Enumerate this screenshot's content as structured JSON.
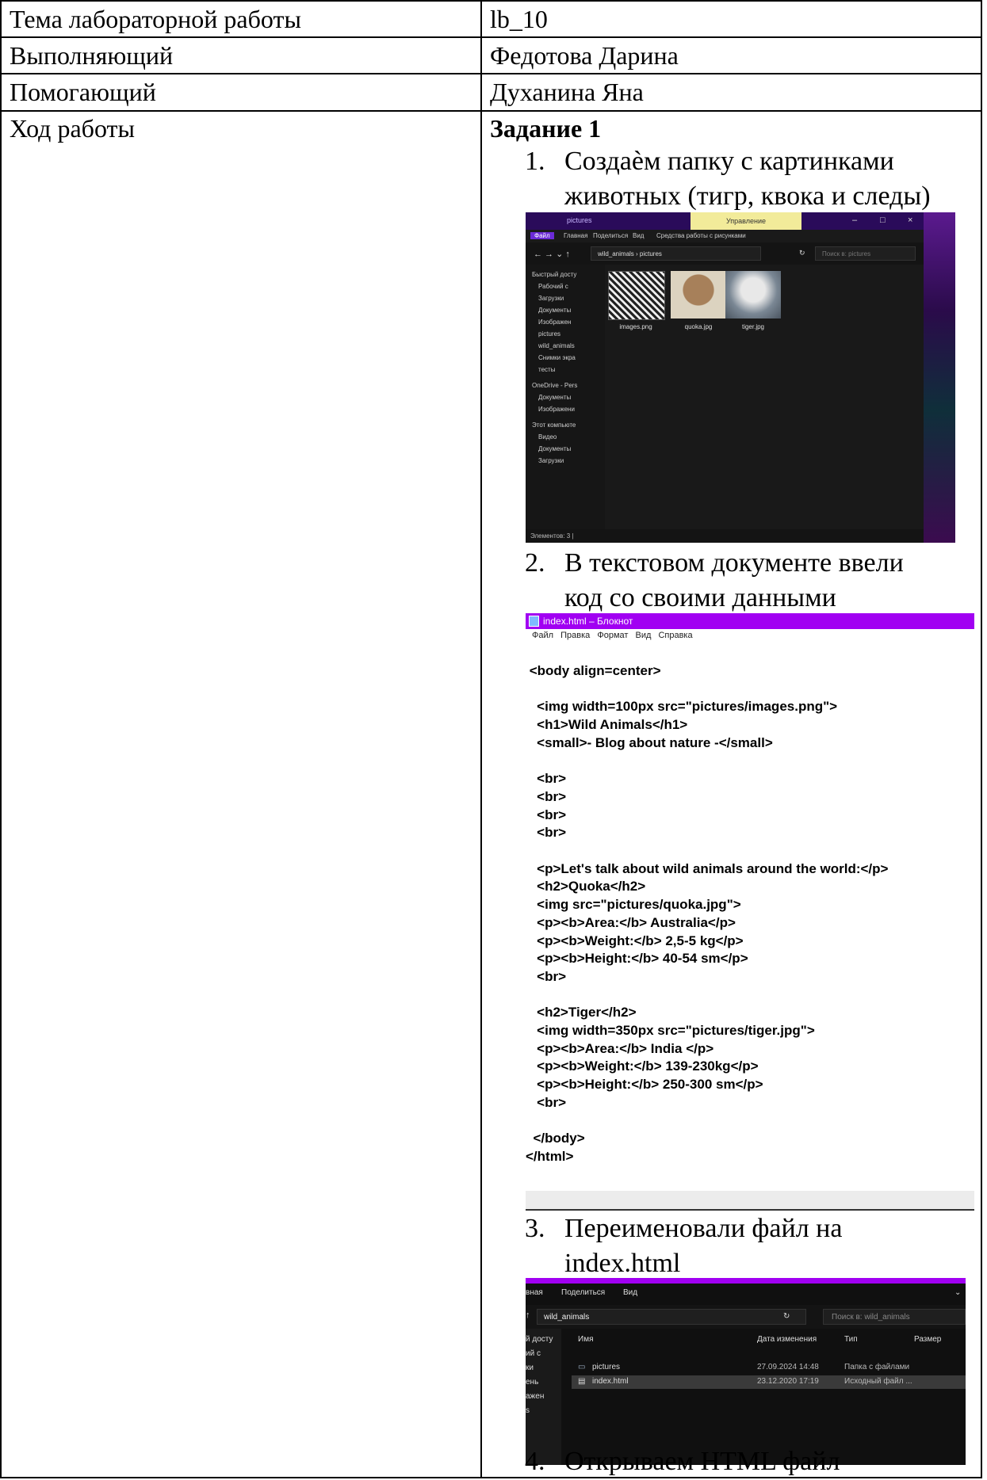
{
  "table": {
    "rows": [
      {
        "label": "Тема лабораторной работы",
        "value": "lb_10"
      },
      {
        "label": "Выполняющий",
        "value": "Федотова Дарина"
      },
      {
        "label": "Помогающий",
        "value": "Духанина Яна"
      },
      {
        "label": "Ход работы",
        "value": "Задание 1"
      }
    ]
  },
  "steps": [
    {
      "num": "1.",
      "lines": [
        "Создаѐм папку с картинками",
        "животных (тигр, квока и следы)"
      ]
    },
    {
      "num": "2.",
      "lines": [
        "В текстовом документе ввели",
        "код со  своими данными"
      ]
    },
    {
      "num": "3.",
      "lines": [
        "Переименовали файл на",
        "index.html"
      ]
    },
    {
      "num": "4.",
      "lines": [
        "Открываем HTML файл"
      ]
    }
  ],
  "explorer1": {
    "title": "pictures",
    "manage": "Управление",
    "ribbon": [
      "Файл",
      "Главная",
      "Поделиться",
      "Вид",
      "Средства работы с рисунками"
    ],
    "path": "wild_animals  ›  pictures",
    "search_placeholder": "Поиск в: pictures",
    "sidebar": [
      "Быстрый досту",
      "Рабочий с",
      "Загрузки",
      "Документы",
      "Изображен",
      "pictures",
      "wild_animals",
      "Снимки экра",
      "тесты",
      "OneDrive - Pers",
      "Документы",
      "Изображени",
      "Этот компьюте",
      "Видео",
      "Документы",
      "Загрузки"
    ],
    "files": [
      "images.png",
      "quoka.jpg",
      "tiger.jpg"
    ],
    "status": "Элементов: 3  |"
  },
  "notepad": {
    "title": "index.html – Блокнот",
    "menu": [
      "Файл",
      "Правка",
      "Формат",
      "Вид",
      "Справка"
    ],
    "code": [
      " <body align=center>",
      "",
      "   <img width=100px src=\"pictures/images.png\">",
      "   <h1>Wild Animals</h1>",
      "   <small>- Blog about nature -</small>",
      "",
      "   <br>",
      "   <br>",
      "   <br>",
      "   <br>",
      "",
      "   <p>Let's talk about wild animals around the world:</p>",
      "   <h2>Quoka</h2>",
      "   <img src=\"pictures/quoka.jpg\">",
      "   <p><b>Area:</b> Australia</p>",
      "   <p><b>Weight:</b> 2,5-5 kg</p>",
      "   <p><b>Height:</b> 40-54 sm</p>",
      "   <br>",
      "",
      "   <h2>Tiger</h2>",
      "   <img width=350px src=\"pictures/tiger.jpg\">",
      "   <p><b>Area:</b> India </p>",
      "   <p><b>Weight:</b> 139-230kg</p>",
      "   <p><b>Height:</b> 250-300 sm</p>",
      "   <br>",
      "",
      "  </body>",
      "</html>"
    ]
  },
  "explorer2": {
    "ribbon": [
      "вная",
      "Поделиться",
      "Вид"
    ],
    "path": "wild_animals",
    "search_placeholder": "Поиск в: wild_animals",
    "sidebar": [
      "й досту",
      "ий с",
      "ки",
      "ень",
      "ажен",
      "s"
    ],
    "headers": [
      "Имя",
      "Дата изменения",
      "Тип",
      "Размер"
    ],
    "files": [
      {
        "name": "pictures",
        "date": "27.09.2024 14:48",
        "type": "Папка с файлами"
      },
      {
        "name": "index.html",
        "date": "23.12.2020 17:19",
        "type": "Исходный файл ..."
      }
    ]
  }
}
